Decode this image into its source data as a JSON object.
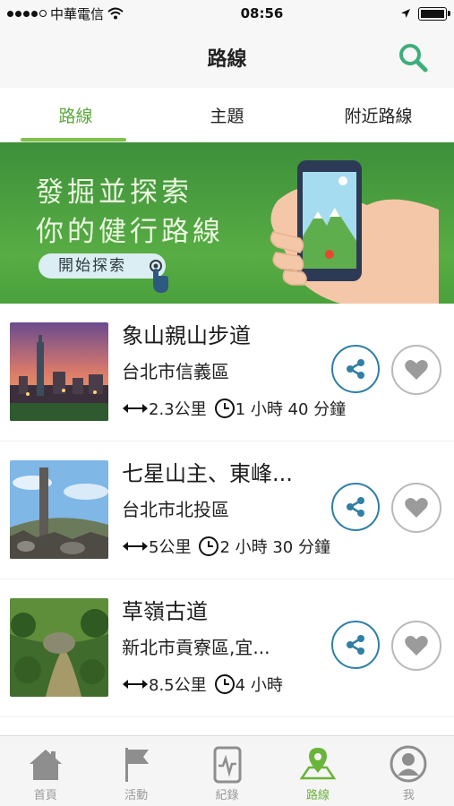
{
  "status_bar": {
    "carrier": "中華電信",
    "time": "08:56"
  },
  "header": {
    "title": "路線"
  },
  "tabs": [
    {
      "label": "路線",
      "active": true
    },
    {
      "label": "主題",
      "active": false
    },
    {
      "label": "附近路線",
      "active": false
    }
  ],
  "banner": {
    "line1": "發掘並探索",
    "line2": "你的健行路線",
    "button_label": "開始探索"
  },
  "routes": [
    {
      "name": "象山親山步道",
      "location": "台北市信義區",
      "distance": "2.3公里",
      "duration": "1 小時 40 分鐘"
    },
    {
      "name": "七星山主、東峰...",
      "location": "台北市北投區",
      "distance": "5公里",
      "duration": "2 小時 30 分鐘"
    },
    {
      "name": "草嶺古道",
      "location": "新北市貢寮區,宜...",
      "distance": "8.5公里",
      "duration": "4 小時"
    }
  ],
  "tabbar": [
    {
      "label": "首頁",
      "icon": "home-icon",
      "active": false
    },
    {
      "label": "活動",
      "icon": "flag-icon",
      "active": false
    },
    {
      "label": "紀錄",
      "icon": "record-icon",
      "active": false
    },
    {
      "label": "路線",
      "icon": "map-pin-icon",
      "active": true
    },
    {
      "label": "我",
      "icon": "profile-icon",
      "active": false
    }
  ],
  "colors": {
    "accent_green": "#6bb43b",
    "share_blue": "#2f7fa6",
    "banner_green": "#4aa03b"
  }
}
